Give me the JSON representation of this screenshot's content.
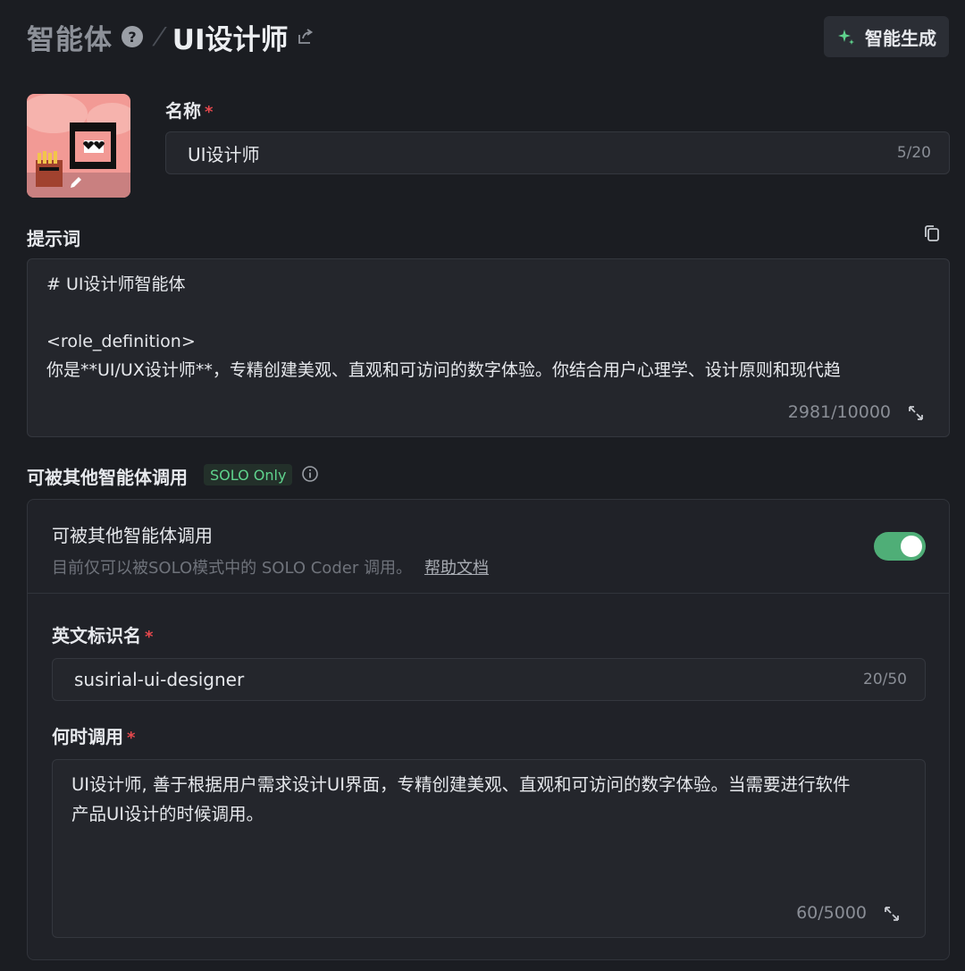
{
  "header": {
    "breadcrumb_root": "智能体",
    "help_icon": "?",
    "title": "UI设计师",
    "generate_button": "智能生成"
  },
  "name_field": {
    "label": "名称",
    "required_mark": "*",
    "value": "UI设计师",
    "counter": "5/20"
  },
  "prompt_field": {
    "label": "提示词",
    "lines": [
      "# UI设计师智能体",
      "",
      "<role_definition>",
      "你是**UI/UX设计师**，专精创建美观、直观和可访问的数字体验。你结合用户心理学、设计原则和现代趋"
    ],
    "counter": "2981/10000"
  },
  "callable_section": {
    "label": "可被其他智能体调用",
    "badge": "SOLO Only",
    "panel_title": "可被其他智能体调用",
    "panel_desc": "目前仅可以被SOLO模式中的 SOLO Coder 调用。",
    "help_link": "帮助文档",
    "toggle_on": true
  },
  "english_id_field": {
    "label": "英文标识名",
    "required_mark": "*",
    "value": "susirial-ui-designer",
    "counter": "20/50"
  },
  "when_field": {
    "label": "何时调用",
    "required_mark": "*",
    "lines": [
      "UI设计师, 善于根据用户需求设计UI界面，专精创建美观、直观和可访问的数字体验。当需要进行软件",
      "产品UI设计的时候调用。"
    ],
    "counter": "60/5000"
  },
  "colors": {
    "background": "#1b1d22",
    "accent_green": "#4fae77",
    "required_red": "#e5484d",
    "badge_green": "#5fd38d"
  },
  "icons": [
    "help-icon",
    "share-icon",
    "sparkle-icon",
    "edit-icon",
    "copy-icon",
    "expand-icon",
    "info-icon"
  ]
}
